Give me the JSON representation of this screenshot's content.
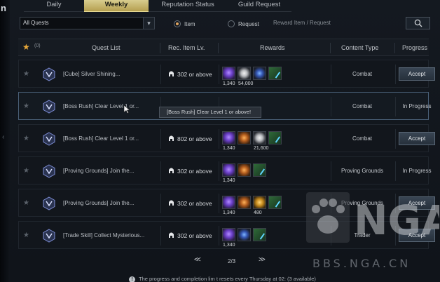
{
  "edge_text": "n",
  "tabs": [
    {
      "label": "Daily",
      "active": false
    },
    {
      "label": "Weekly",
      "active": true
    },
    {
      "label": "Reputation Status",
      "active": false
    },
    {
      "label": "Guild Request",
      "active": false
    }
  ],
  "filter": {
    "dropdown_value": "All Quests",
    "radio_item": "Item",
    "radio_request": "Request",
    "radio_selected": "Item",
    "search_placeholder": "Reward Item / Request"
  },
  "table": {
    "star_count": "(0)",
    "headers": {
      "quest_list": "Quest List",
      "rec_item_lv": "Rec. Item Lv.",
      "rewards": "Rewards",
      "content_type": "Content Type",
      "progress": "Progress"
    },
    "rows": [
      {
        "name": "[Cube] Silver Shining...",
        "level": "302 or above",
        "rewards": [
          {
            "icon": "purple-gem-icon",
            "qty": "1,340"
          },
          {
            "icon": "silver-coin-icon",
            "qty": "54,000"
          },
          {
            "icon": "blue-orb-icon",
            "qty": ""
          },
          {
            "icon": "green-shard-icon",
            "qty": ""
          }
        ],
        "content_type": "Combat",
        "progress": "",
        "action": "Accept"
      },
      {
        "name": "[Boss Rush] Clear Level 1 or...",
        "level": "",
        "rewards": [],
        "content_type": "Combat",
        "progress": "In Progress",
        "action": ""
      },
      {
        "name": "[Boss Rush] Clear Level 1 or...",
        "level": "802 or above",
        "rewards": [
          {
            "icon": "purple-gem-icon",
            "qty": "1,340"
          },
          {
            "icon": "orange-chest-icon",
            "qty": ""
          },
          {
            "icon": "silver-coin-icon",
            "qty": "21,600"
          },
          {
            "icon": "green-shard-icon",
            "qty": ""
          }
        ],
        "content_type": "Combat",
        "progress": "",
        "action": "Accept"
      },
      {
        "name": "[Proving Grounds] Join the...",
        "level": "302 or above",
        "rewards": [
          {
            "icon": "purple-gem-icon",
            "qty": "1,340"
          },
          {
            "icon": "orange-chest-icon",
            "qty": ""
          },
          {
            "icon": "green-shard-icon",
            "qty": ""
          }
        ],
        "content_type": "Proving Grounds",
        "progress": "In Progress",
        "action": ""
      },
      {
        "name": "[Proving Grounds] Join the...",
        "level": "302 or above",
        "rewards": [
          {
            "icon": "purple-gem-icon",
            "qty": "1,340"
          },
          {
            "icon": "orange-chest-icon",
            "qty": ""
          },
          {
            "icon": "gold-chest-icon",
            "qty": "480"
          },
          {
            "icon": "green-shard-icon",
            "qty": ""
          }
        ],
        "content_type": "Proving Grounds",
        "progress": "",
        "action": "Accept"
      },
      {
        "name": "[Trade Skill] Collect Mysterious...",
        "level": "302 or above",
        "rewards": [
          {
            "icon": "purple-gem-icon",
            "qty": "1,340"
          },
          {
            "icon": "blue-orb-icon",
            "qty": ""
          },
          {
            "icon": "green-shard-icon",
            "qty": ""
          }
        ],
        "content_type": "Trader",
        "progress": "",
        "action": "Accept"
      }
    ]
  },
  "tooltip": "[Boss Rush] Clear Level 1 or above!",
  "pagination": {
    "first": "<<",
    "page": "2/3",
    "last": ">>"
  },
  "notice": "The progress and completion lim t resets every Thursday at 02: (3 available)",
  "watermark": "BBS.NGA.CN",
  "watermark_logo": "NGA",
  "colors": {
    "active_tab": "#c9b86a",
    "accent_star": "#e8a83a"
  }
}
